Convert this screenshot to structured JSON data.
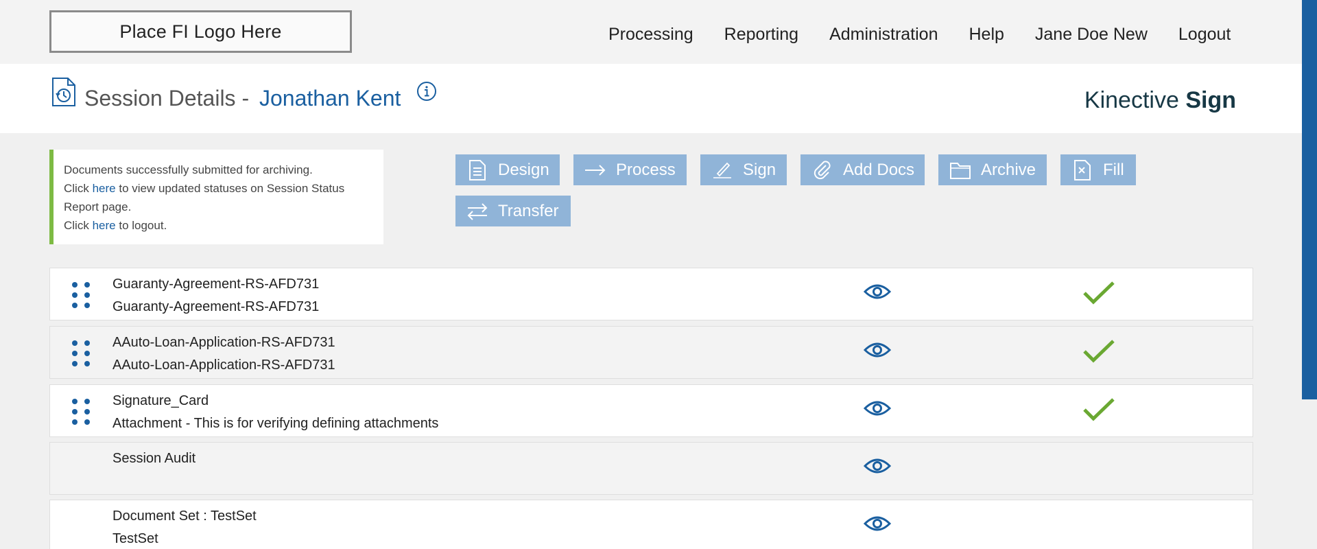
{
  "topbar": {
    "logo_text": "Place FI Logo Here",
    "nav": [
      "Processing",
      "Reporting",
      "Administration",
      "Help",
      "Jane Doe New",
      "Logout"
    ]
  },
  "header": {
    "title_prefix": "Session Details -",
    "customer_name": "Jonathan Kent",
    "brand_light": "Kinective",
    "brand_bold": "Sign"
  },
  "notice": {
    "line1": "Documents successfully submitted for archiving.",
    "line2_pre": "Click",
    "line2_link": "here",
    "line2_post": "to view updated statuses on Session Status Report page.",
    "line3_pre": "Click",
    "line3_link": "here",
    "line3_post": "to logout."
  },
  "actions": [
    {
      "label": "Design",
      "icon": "document-list-icon"
    },
    {
      "label": "Process",
      "icon": "arrow-right-icon"
    },
    {
      "label": "Sign",
      "icon": "pen-sign-icon"
    },
    {
      "label": "Add Docs",
      "icon": "paperclip-icon"
    },
    {
      "label": "Archive",
      "icon": "folder-icon"
    },
    {
      "label": "Fill",
      "icon": "file-x-icon"
    },
    {
      "label": "Transfer",
      "icon": "transfer-arrows-icon"
    }
  ],
  "documents": [
    {
      "name": "Guaranty-Agreement-RS-AFD731",
      "description": "Guaranty-Agreement-RS-AFD731",
      "draggable": true,
      "complete": true
    },
    {
      "name": "AAuto-Loan-Application-RS-AFD731",
      "description": "AAuto-Loan-Application-RS-AFD731",
      "draggable": true,
      "complete": true
    },
    {
      "name": "Signature_Card",
      "description": "Attachment - This is for verifying defining attachments",
      "draggable": true,
      "complete": true
    },
    {
      "name": "Session Audit",
      "description": "",
      "draggable": false,
      "complete": false
    },
    {
      "name": "Document Set : TestSet",
      "description": "TestSet",
      "draggable": false,
      "complete": false
    }
  ],
  "colors": {
    "accent": "#1a5fa0",
    "button": "#90b4d8",
    "success": "#6aa832",
    "notice_bar": "#7dba43"
  }
}
